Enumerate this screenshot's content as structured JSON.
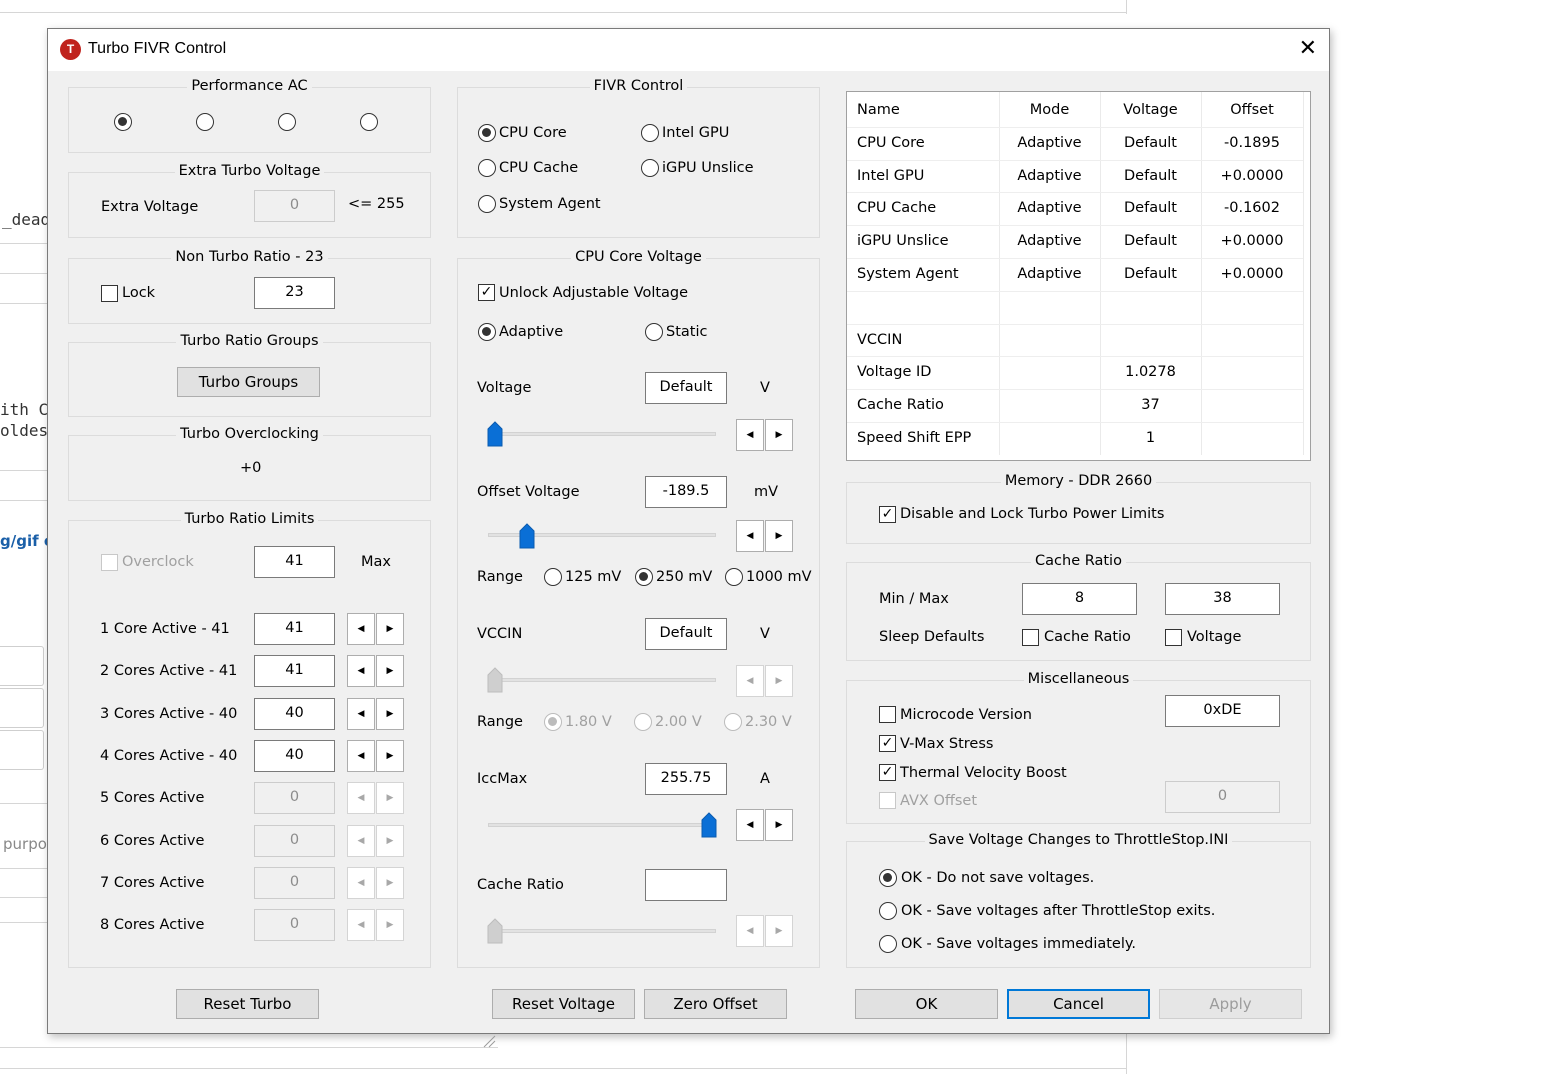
{
  "background_page": {
    "fragments": [
      "_dead",
      "ith C",
      "oldes",
      "g/gif o",
      "purpo"
    ]
  },
  "dialog": {
    "title": "Turbo FIVR Control",
    "app_icon_letter": "T",
    "close_glyph": "✕"
  },
  "performance_ac": {
    "title": "Performance AC",
    "selected_index": 0,
    "option_count": 4
  },
  "extra_turbo_voltage": {
    "title": "Extra Turbo Voltage",
    "label": "Extra Voltage",
    "value": "0",
    "limit": "<= 255"
  },
  "non_turbo_ratio": {
    "title": "Non Turbo Ratio - 23",
    "lock_label": "Lock",
    "lock_checked": false,
    "value": "23"
  },
  "turbo_ratio_groups": {
    "title": "Turbo Ratio Groups",
    "button": "Turbo Groups"
  },
  "turbo_overclocking": {
    "title": "Turbo Overclocking",
    "value": "+0"
  },
  "turbo_ratio_limits": {
    "title": "Turbo Ratio Limits",
    "overclock_label": "Overclock",
    "overclock_value": "41",
    "max_label": "Max",
    "rows": [
      {
        "label": "1 Core  Active - 41",
        "value": "41",
        "enabled": true
      },
      {
        "label": "2 Cores Active - 41",
        "value": "41",
        "enabled": true
      },
      {
        "label": "3 Cores Active - 40",
        "value": "40",
        "enabled": true
      },
      {
        "label": "4 Cores Active - 40",
        "value": "40",
        "enabled": true
      },
      {
        "label": "5 Cores Active",
        "value": "0",
        "enabled": false
      },
      {
        "label": "6 Cores Active",
        "value": "0",
        "enabled": false
      },
      {
        "label": "7 Cores Active",
        "value": "0",
        "enabled": false
      },
      {
        "label": "8 Cores Active",
        "value": "0",
        "enabled": false
      }
    ]
  },
  "fivr_control": {
    "title": "FIVR Control",
    "options": {
      "cpu_core": "CPU Core",
      "intel_gpu": "Intel GPU",
      "cpu_cache": "CPU Cache",
      "igpu_unslice": "iGPU Unslice",
      "system_agent": "System Agent"
    },
    "selected": "CPU Core"
  },
  "cpu_core_voltage": {
    "title": "CPU Core Voltage",
    "unlock_label": "Unlock Adjustable Voltage",
    "unlock_checked": true,
    "mode_adaptive": "Adaptive",
    "mode_static": "Static",
    "selected_mode": "Adaptive",
    "voltage_label": "Voltage",
    "voltage_value": "Default",
    "voltage_unit": "V",
    "voltage_slider_fraction": 0.0,
    "offset_label": "Offset Voltage",
    "offset_value": "-189.5",
    "offset_unit": "mV",
    "offset_slider_fraction": 0.15,
    "range_label": "Range",
    "offset_ranges": [
      "125 mV",
      "250 mV",
      "1000 mV"
    ],
    "offset_range_selected": "250 mV",
    "vccin_label": "VCCIN",
    "vccin_value": "Default",
    "vccin_unit": "V",
    "vccin_slider_fraction": 0.0,
    "vccin_ranges": [
      "1.80 V",
      "2.00 V",
      "2.30 V"
    ],
    "vccin_range_selected": "1.80 V",
    "iccmax_label": "IccMax",
    "iccmax_value": "255.75",
    "iccmax_unit": "A",
    "iccmax_slider_fraction": 1.0,
    "cache_ratio_label": "Cache Ratio",
    "cache_ratio_value": "",
    "cache_slider_fraction": 0.0
  },
  "fivr_table": {
    "headers": [
      "Name",
      "Mode",
      "Voltage",
      "Offset"
    ],
    "rows": [
      [
        "CPU Core",
        "Adaptive",
        "Default",
        "-0.1895"
      ],
      [
        "Intel GPU",
        "Adaptive",
        "Default",
        "+0.0000"
      ],
      [
        "CPU Cache",
        "Adaptive",
        "Default",
        "-0.1602"
      ],
      [
        "iGPU Unslice",
        "Adaptive",
        "Default",
        "+0.0000"
      ],
      [
        "System Agent",
        "Adaptive",
        "Default",
        "+0.0000"
      ],
      [
        "",
        "",
        "",
        ""
      ],
      [
        "VCCIN",
        "",
        "",
        ""
      ],
      [
        "Voltage ID",
        "",
        "1.0278",
        ""
      ],
      [
        "Cache Ratio",
        "",
        "37",
        ""
      ],
      [
        "Speed Shift EPP",
        "",
        "1",
        ""
      ]
    ]
  },
  "memory": {
    "title": "Memory - DDR 2660",
    "disable_lock_label": "Disable and Lock Turbo Power Limits",
    "disable_lock_checked": true
  },
  "cache_ratio": {
    "title": "Cache Ratio",
    "minmax_label": "Min / Max",
    "min": "8",
    "max": "38",
    "sleep_defaults_label": "Sleep Defaults",
    "cache_ratio_label": "Cache Ratio",
    "cache_ratio_checked": false,
    "voltage_label": "Voltage",
    "voltage_checked": false
  },
  "miscellaneous": {
    "title": "Miscellaneous",
    "microcode_label": "Microcode Version",
    "microcode_checked": false,
    "microcode_value": "0xDE",
    "vmax_label": "V-Max Stress",
    "vmax_checked": true,
    "tvb_label": "Thermal Velocity Boost",
    "tvb_checked": true,
    "avx_label": "AVX Offset",
    "avx_checked": false,
    "avx_value": "0"
  },
  "save_voltage": {
    "title": "Save Voltage Changes to ThrottleStop.INI",
    "options": [
      "OK - Do not save voltages.",
      "OK - Save voltages after ThrottleStop exits.",
      "OK - Save voltages immediately."
    ],
    "selected_index": 0
  },
  "buttons": {
    "reset_turbo": "Reset Turbo",
    "reset_voltage": "Reset Voltage",
    "zero_offset": "Zero Offset",
    "ok": "OK",
    "cancel": "Cancel",
    "apply": "Apply"
  },
  "colors": {
    "accent": "#0078d7",
    "slider_thumb": "#0a6fd6",
    "dialog_bg": "#f0f0f0",
    "app_icon": "#c0231d"
  }
}
